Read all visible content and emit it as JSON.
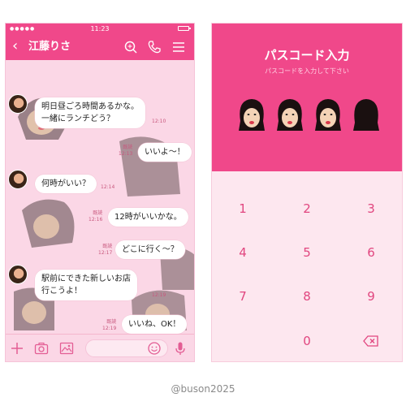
{
  "status_bar": {
    "time": "11:23",
    "signal": "●●●●●"
  },
  "chat": {
    "title": "江藤りさ",
    "messages": [
      {
        "side": "left",
        "lines": [
          "明日昼ごろ時間あるかな。",
          "一緒にランチどう？"
        ],
        "time": "12:10"
      },
      {
        "side": "right",
        "lines": [
          "いいよ〜！"
        ],
        "read": "既読",
        "time": "12:13"
      },
      {
        "side": "left",
        "lines": [
          "何時がいい？"
        ],
        "time": "12:14"
      },
      {
        "side": "right",
        "lines": [
          "12時がいいかな。"
        ],
        "read": "既読",
        "time": "12:16"
      },
      {
        "side": "right",
        "lines": [
          "どこに行く〜？"
        ],
        "read": "既読",
        "time": "12:17"
      },
      {
        "side": "left",
        "lines": [
          "駅前にできた新しいお店",
          "行こうよ！"
        ],
        "time": "12:19"
      },
      {
        "side": "right",
        "lines": [
          "いいね、OK！"
        ],
        "read": "既読",
        "time": "12:19"
      }
    ]
  },
  "passcode": {
    "title": "パスコード入力",
    "subtitle": "パスコードを入力して下さい",
    "keys": [
      "1",
      "2",
      "3",
      "4",
      "5",
      "6",
      "7",
      "8",
      "9",
      "0"
    ]
  },
  "colors": {
    "accent": "#f0488a",
    "chat_bg": "#fbd7e6",
    "key_text": "#e1467f"
  },
  "watermark": "@buson2025"
}
